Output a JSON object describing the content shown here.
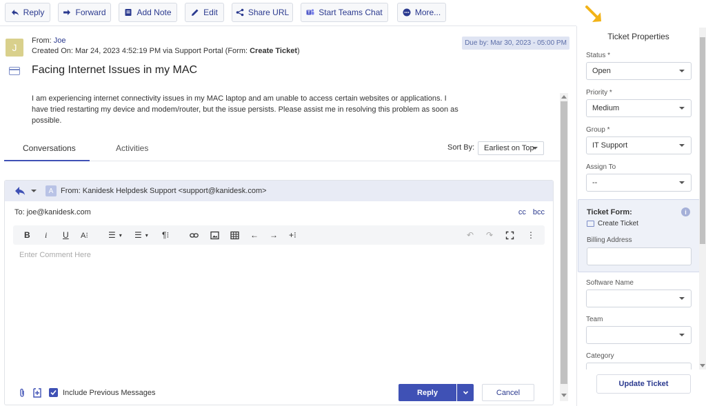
{
  "toolbar": {
    "reply": "Reply",
    "forward": "Forward",
    "add_note": "Add Note",
    "edit": "Edit",
    "share_url": "Share URL",
    "teams": "Start Teams Chat",
    "more": "More..."
  },
  "ticket": {
    "avatar_letter": "J",
    "from_label": "From:",
    "from_name": "Joe",
    "created_prefix": "Created On: Mar 24, 2023 4:52:19 PM via Support Portal (Form:",
    "created_form": "Create Ticket",
    "created_suffix": ")",
    "due": "Due by: Mar 30, 2023 - 05:00 PM",
    "subject": "Facing Internet Issues in my MAC",
    "description": "I am experiencing internet connectivity issues in my MAC laptop and am unable to access certain websites or applications. I have tried restarting my device and modem/router, but the issue persists. Please assist me in resolving this problem as soon as possible."
  },
  "tabs": {
    "conversations": "Conversations",
    "activities": "Activities",
    "sort_label": "Sort By:",
    "sort_value": "Earliest on Top"
  },
  "composer": {
    "avatar_letter": "A",
    "from": "From: Kanidesk Helpdesk Support <support@kanidesk.com>",
    "to": "To: joe@kanidesk.com",
    "cc": "cc",
    "bcc": "bcc",
    "placeholder": "Enter Comment Here",
    "include_prev": "Include Previous Messages",
    "reply": "Reply",
    "cancel": "Cancel"
  },
  "properties": {
    "title": "Ticket Properties",
    "status_label": "Status *",
    "status_value": "Open",
    "priority_label": "Priority *",
    "priority_value": "Medium",
    "group_label": "Group *",
    "group_value": "IT Support",
    "assign_label": "Assign To",
    "assign_value": "--",
    "form_title": "Ticket Form:",
    "form_value": "Create Ticket",
    "billing_label": "Billing Address",
    "software_label": "Software Name",
    "team_label": "Team",
    "category_label": "Category",
    "update": "Update Ticket"
  },
  "colors": {
    "accent": "#3f51b5",
    "link": "#2b3a8f",
    "annotation_arrow": "#f2b318"
  }
}
